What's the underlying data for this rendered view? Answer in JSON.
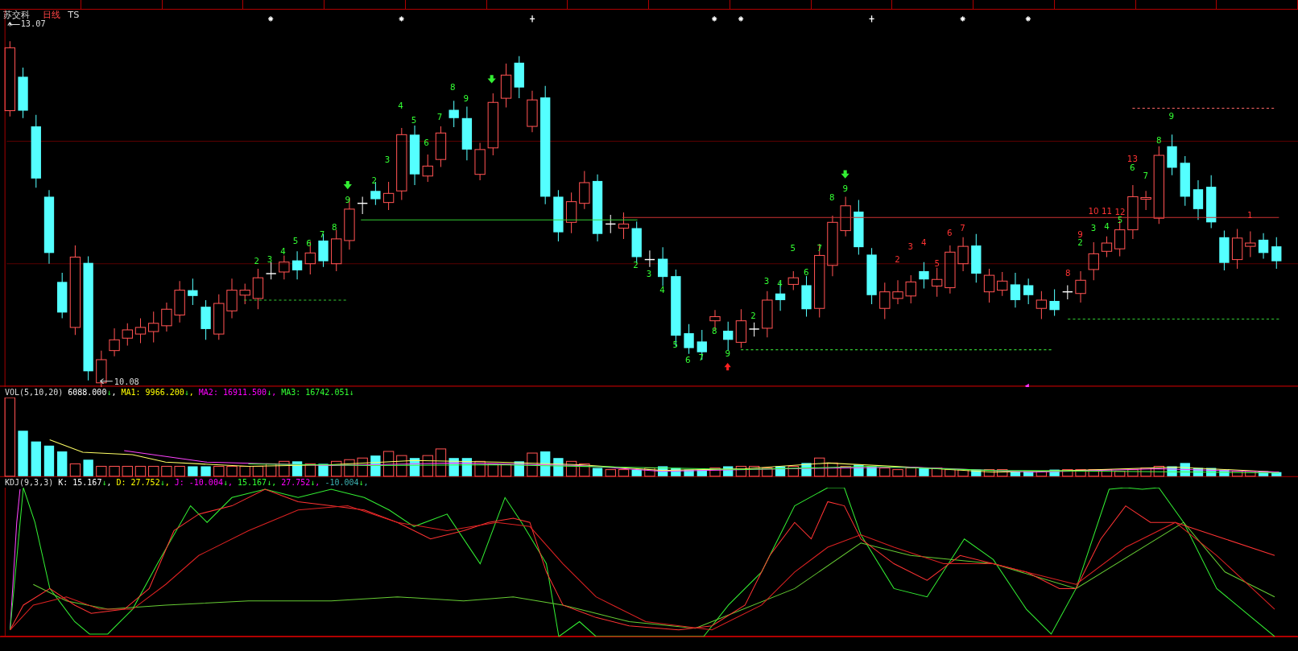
{
  "security": {
    "name": "苏交科",
    "period": "日线",
    "indicator": "TS"
  },
  "price_panel": {
    "high_label": "13.07",
    "low_label": "10.08",
    "count_marks": [
      {
        "label": "2",
        "color": "#33ff33"
      },
      {
        "label": "3",
        "color": "#33ff33"
      },
      {
        "label": "4",
        "color": "#33ff33"
      },
      {
        "label": "5",
        "color": "#33ff33"
      },
      {
        "label": "6",
        "color": "#33ff33"
      },
      {
        "label": "7",
        "color": "#33ff33"
      },
      {
        "label": "8",
        "color": "#33ff33"
      },
      {
        "label": "9",
        "color": "#33ff33"
      },
      {
        "label": "2",
        "color": "#33ff33"
      },
      {
        "label": "3",
        "color": "#33ff33"
      },
      {
        "label": "4",
        "color": "#33ff33"
      },
      {
        "label": "5",
        "color": "#33ff33"
      },
      {
        "label": "6",
        "color": "#33ff33"
      },
      {
        "label": "7",
        "color": "#33ff33"
      },
      {
        "label": "8",
        "color": "#33ff33"
      },
      {
        "label": "9",
        "color": "#33ff33"
      },
      {
        "label": "2",
        "color": "#33ff33"
      },
      {
        "label": "3",
        "color": "#33ff33"
      },
      {
        "label": "4",
        "color": "#33ff33"
      },
      {
        "label": "5",
        "color": "#33ff33"
      },
      {
        "label": "6",
        "color": "#33ff33"
      },
      {
        "label": "7",
        "color": "#33ff33"
      },
      {
        "label": "8",
        "color": "#33ff33"
      },
      {
        "label": "9",
        "color": "#33ff33"
      },
      {
        "label": "2",
        "color": "#33ff33"
      },
      {
        "label": "3",
        "color": "#33ff33"
      },
      {
        "label": "4",
        "color": "#33ff33"
      },
      {
        "label": "5",
        "color": "#33ff33"
      },
      {
        "label": "6",
        "color": "#33ff33"
      },
      {
        "label": "7",
        "color": "#33ff33"
      },
      {
        "label": "8",
        "color": "#33ff33"
      },
      {
        "label": "9",
        "color": "#33ff33"
      },
      {
        "label": "2",
        "color": "#ff3333"
      },
      {
        "label": "3",
        "color": "#ff3333"
      },
      {
        "label": "4",
        "color": "#ff3333"
      },
      {
        "label": "5",
        "color": "#ff3333"
      },
      {
        "label": "6",
        "color": "#ff3333"
      },
      {
        "label": "7",
        "color": "#ff3333"
      },
      {
        "label": "8",
        "color": "#ff3333"
      },
      {
        "label": "9",
        "color": "#ff3333"
      },
      {
        "label": "10",
        "color": "#ff3333"
      },
      {
        "label": "11",
        "color": "#ff3333"
      },
      {
        "label": "12",
        "color": "#ff3333"
      },
      {
        "label": "13",
        "color": "#ff3333"
      },
      {
        "label": "2",
        "color": "#33ff33"
      },
      {
        "label": "3",
        "color": "#33ff33"
      },
      {
        "label": "4",
        "color": "#33ff33"
      },
      {
        "label": "5",
        "color": "#33ff33"
      },
      {
        "label": "6",
        "color": "#33ff33"
      },
      {
        "label": "7",
        "color": "#33ff33"
      },
      {
        "label": "8",
        "color": "#33ff33"
      },
      {
        "label": "9",
        "color": "#33ff33"
      },
      {
        "label": "1",
        "color": "#ff3333"
      }
    ]
  },
  "volume_panel": {
    "title": "VOL(5,10,20)",
    "readouts": [
      {
        "text": "6088.000",
        "arrow": "↓",
        "sep": ",",
        "color": "#ffffff"
      },
      {
        "text": "MA1: 9966.200",
        "arrow": "↓",
        "sep": ",",
        "color": "#ffff00"
      },
      {
        "text": "MA2: 16911.500",
        "arrow": "↓",
        "sep": ",",
        "color": "#ff00ff"
      },
      {
        "text": "MA3: 16742.051",
        "arrow": "↓",
        "color": "#33ff33"
      }
    ]
  },
  "kdj_panel": {
    "title": "KDJ(9,3,3)",
    "readouts": [
      {
        "text": "K: 15.167",
        "arrow": "↓",
        "sep": ",",
        "color": "#ffffff"
      },
      {
        "text": "D: 27.752",
        "arrow": "↓",
        "sep": ",",
        "color": "#ffff00"
      },
      {
        "text": "J: -10.004",
        "arrow": "↓",
        "sep": ",",
        "color": "#ff00ff"
      },
      {
        "text": "15.167",
        "arrow": "↓",
        "sep": ",",
        "color": "#33ff33"
      },
      {
        "text": "27.752",
        "arrow": "↓",
        "sep": ",",
        "color": "#ff00ff"
      },
      {
        "text": "-10.004",
        "arrow": "↓",
        "sep": ",",
        "color": "#3cb0b0"
      }
    ]
  }
}
